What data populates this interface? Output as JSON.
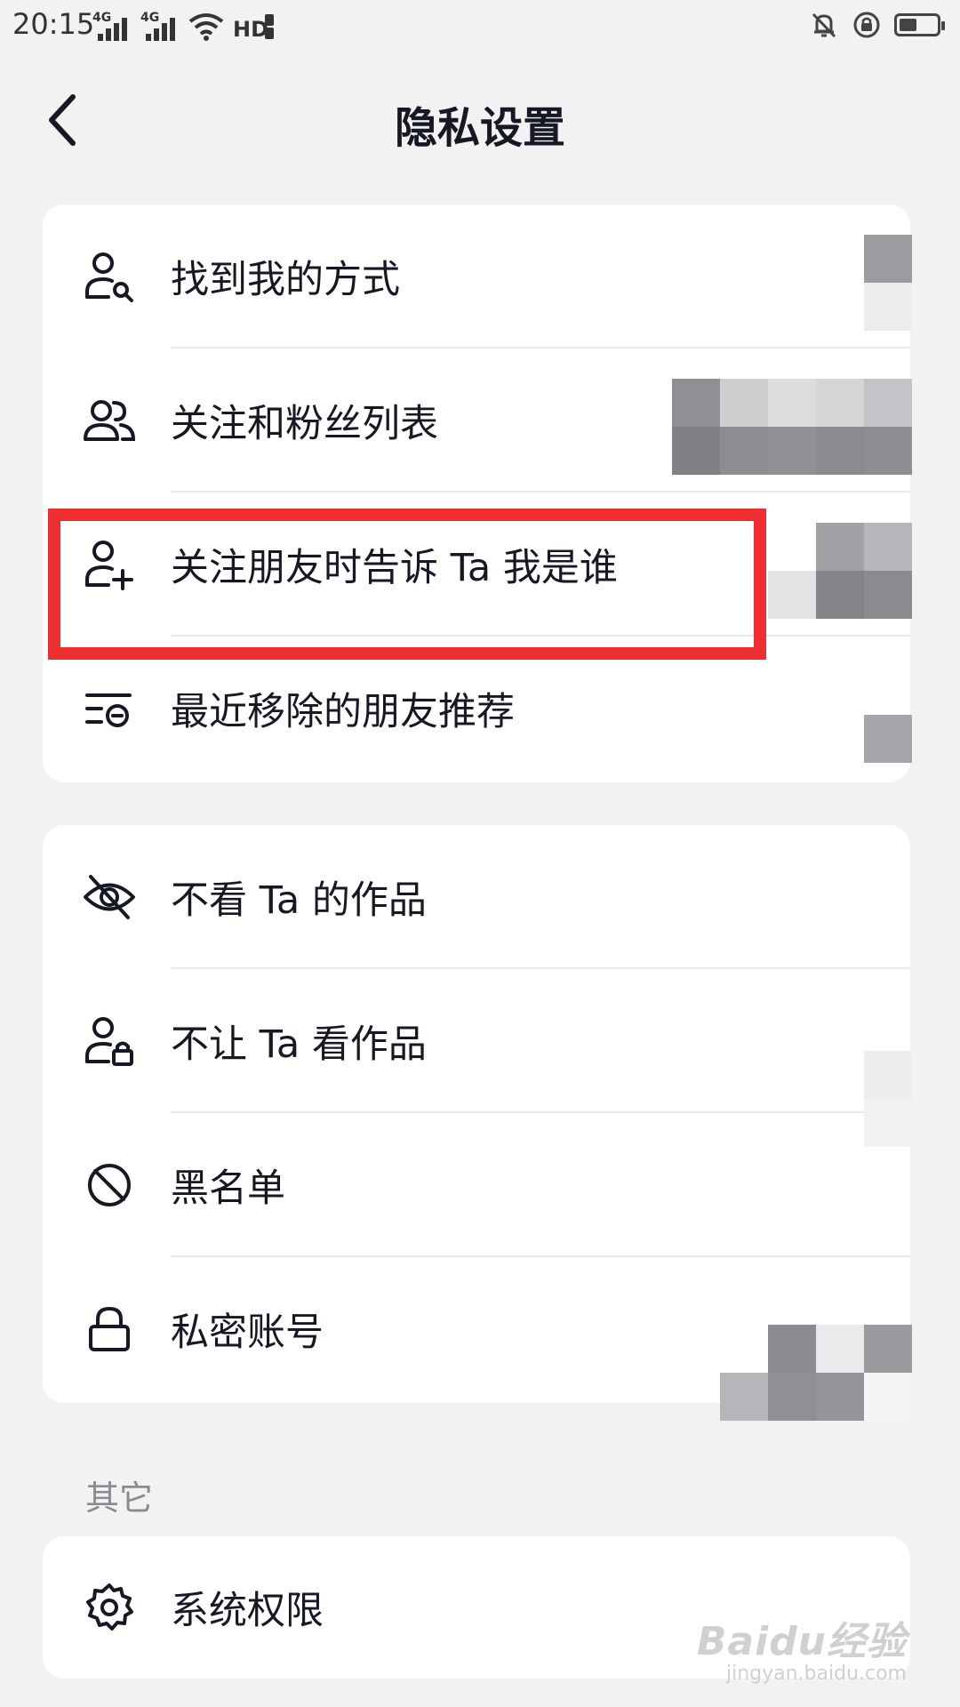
{
  "status_bar": {
    "time": "20:15",
    "signal_1_tag": "4G",
    "signal_2_tag": "4G",
    "hd_label": "HD",
    "battery_level_percent": 55,
    "icons": [
      "signal-icon",
      "signal-icon",
      "wifi-icon",
      "hd-icon",
      "mute-bell-icon",
      "rotation-lock-icon",
      "battery-icon"
    ]
  },
  "header": {
    "title": "隐私设置",
    "back_icon": "chevron-left-icon"
  },
  "group_1": {
    "items": [
      {
        "label": "找到我的方式",
        "icon": "user-search-icon"
      },
      {
        "label": "关注和粉丝列表",
        "icon": "users-icon"
      },
      {
        "label": "关注朋友时告诉 Ta 我是谁",
        "icon": "user-plus-icon"
      },
      {
        "label": "最近移除的朋友推荐",
        "icon": "list-minus-icon"
      }
    ]
  },
  "group_2": {
    "items": [
      {
        "label": "不看 Ta 的作品",
        "icon": "eye-off-icon"
      },
      {
        "label": "不让 Ta 看作品",
        "icon": "user-lock-icon"
      },
      {
        "label": "黑名单",
        "icon": "block-icon"
      },
      {
        "label": "私密账号",
        "icon": "lock-icon"
      }
    ]
  },
  "other_section": {
    "label": "其它",
    "items": [
      {
        "label": "系统权限",
        "icon": "gear-icon"
      }
    ]
  },
  "annotation": {
    "highlight_color": "#ee2e31"
  },
  "watermark": {
    "main": "Baidu经验",
    "sub": "jingyan.baidu.com"
  }
}
